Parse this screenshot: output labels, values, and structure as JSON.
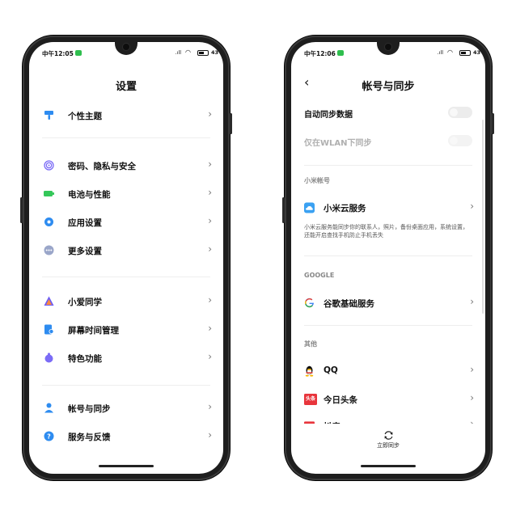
{
  "left": {
    "time": "中午12:05",
    "battery": "43",
    "title": "设置",
    "items": [
      {
        "label": "个性主题",
        "icon": "brush-icon",
        "color": "#2e8cf0"
      },
      {
        "label": "密码、隐私与安全",
        "icon": "fingerprint-icon",
        "color": "#7b6cf6"
      },
      {
        "label": "电池与性能",
        "icon": "battery-icon",
        "color": "#34c759"
      },
      {
        "label": "应用设置",
        "icon": "gear-icon",
        "color": "#2e8cf0"
      },
      {
        "label": "更多设置",
        "icon": "more-icon",
        "color": "#9aa6c9"
      },
      {
        "label": "小爱同学",
        "icon": "xiaoai-icon",
        "color": "#6b5cf6"
      },
      {
        "label": "屏幕时间管理",
        "icon": "screen-time-icon",
        "color": "#2e8cf0"
      },
      {
        "label": "特色功能",
        "icon": "feature-icon",
        "color": "#7b6cf6"
      },
      {
        "label": "帐号与同步",
        "icon": "person-icon",
        "color": "#2e8cf0"
      },
      {
        "label": "服务与反馈",
        "icon": "help-icon",
        "color": "#2e8cf0"
      }
    ]
  },
  "right": {
    "time": "中午12:06",
    "battery": "43",
    "title": "帐号与同步",
    "auto_sync_label": "自动同步数据",
    "wlan_only_label": "仅在WLAN下同步",
    "section_mi": "小米帐号",
    "mi_cloud_label": "小米云服务",
    "mi_cloud_desc": "小米云服务能同步你的联系人，照片，备份桌面应用，系统设置，还能开启查找手机防止手机丢失",
    "section_google": "GOOGLE",
    "google_label": "谷歌基础服务",
    "section_other": "其他",
    "other_items": [
      {
        "label": "QQ",
        "icon": "qq-penguin-icon"
      },
      {
        "label": "今日头条",
        "icon": "toutiao-icon",
        "icon_text": "头条"
      },
      {
        "label": "抖音",
        "icon": "partial-app-icon"
      }
    ],
    "sync_now_label": "立即同步"
  }
}
